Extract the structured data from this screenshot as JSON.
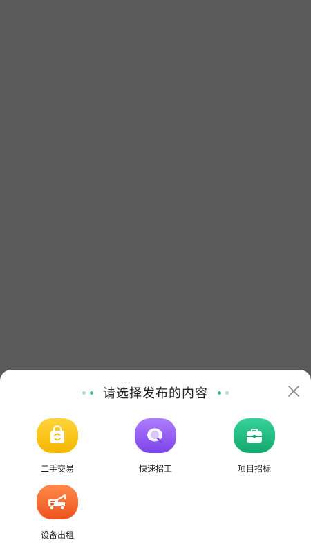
{
  "sheet": {
    "title": "请选择发布的内容"
  },
  "items": [
    {
      "label": "二手交易",
      "icon": "shopping-bag-refresh-icon",
      "color": "#f5b700"
    },
    {
      "label": "快速招工",
      "icon": "chat-search-icon",
      "color": "#7b45e8"
    },
    {
      "label": "项目招标",
      "icon": "toolbox-icon",
      "color": "#14a86e"
    },
    {
      "label": "设备出租",
      "icon": "tow-truck-icon",
      "color": "#ee5320"
    }
  ]
}
